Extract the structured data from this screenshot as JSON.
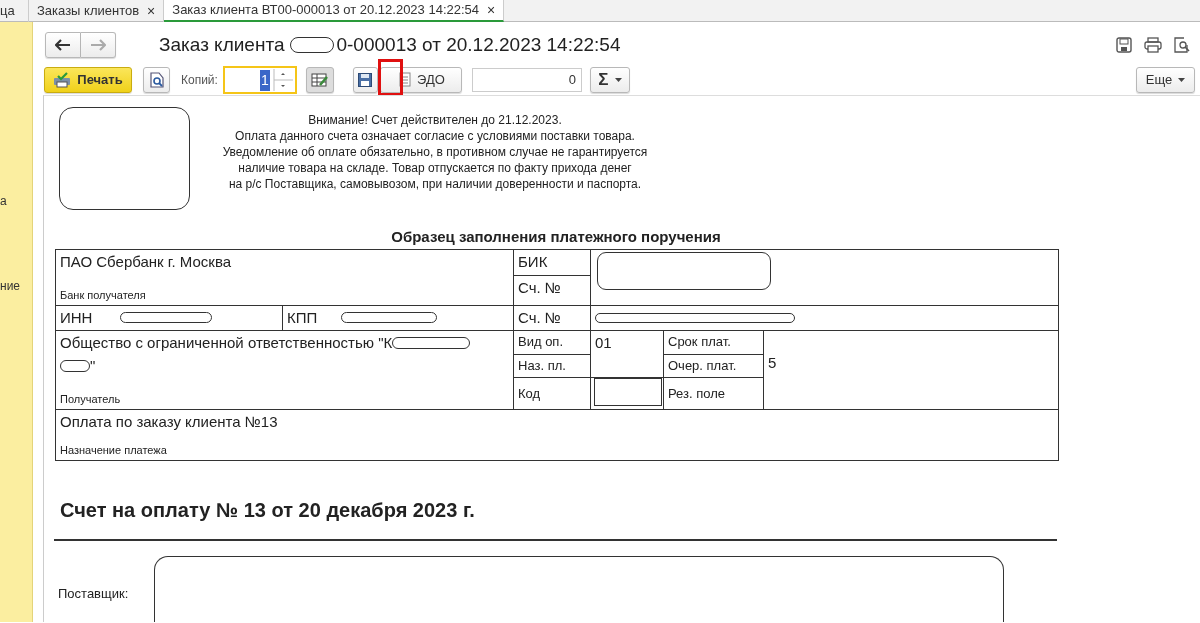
{
  "tabs": [
    {
      "label": "ца",
      "selected": false
    },
    {
      "label": "Заказы клиентов",
      "selected": false,
      "close": "×"
    },
    {
      "label": "Заказ клиента ВТ00-000013 от 20.12.2023 14:22:54",
      "selected": true,
      "close": "×"
    }
  ],
  "sidebar": {
    "items": [
      "а",
      "ние"
    ]
  },
  "form": {
    "title_start": "Заказ клиента",
    "title_end": "0-000013 от 20.12.2023 14:22:54"
  },
  "toolbar": {
    "print": "Печать",
    "copies_label": "Копий:",
    "copies": "1",
    "edo": "ЭДО",
    "total": "0",
    "sum": "Σ",
    "more": "Еще",
    "highlighted": true
  },
  "notice": [
    "Внимание! Счет действителен до 21.12.2023.",
    "Оплата данного счета означает согласие с условиями поставки товара.",
    "Уведомление об оплате обязательно, в противном случае не гарантируется",
    "наличие товара на складе. Товар отпускается по факту прихода денег",
    "на р/с Поставщика, самовывозом, при наличии доверенности и паспорта."
  ],
  "payment_form": {
    "title": "Образец заполнения платежного поручения",
    "bank": "ПАО Сбербанк г. Москва",
    "bank_label": "Банк получателя",
    "bik": "БИК",
    "account1": "Сч. №",
    "inn": "ИНН",
    "kpp": "КПП",
    "account2": "Сч. №",
    "recipient": "Общество с ограниченной ответственностью \"К",
    "recipient_tail": "\"",
    "recipient_label": "Получатель",
    "op_type": "Вид оп.",
    "op_type_value": "01",
    "purpose_code": "Наз. пл.",
    "code": "Код",
    "term": "Срок плат.",
    "priority": "Очер. плат.",
    "priority_value": "5",
    "reserve": "Рез. поле",
    "purpose": "Оплата по заказу клиента №13",
    "purpose_label": "Назначение платежа"
  },
  "invoice": {
    "title": "Счет на оплату № 13 от 20 декабря 2023 г.",
    "supplier_label": "Поставщик:"
  }
}
